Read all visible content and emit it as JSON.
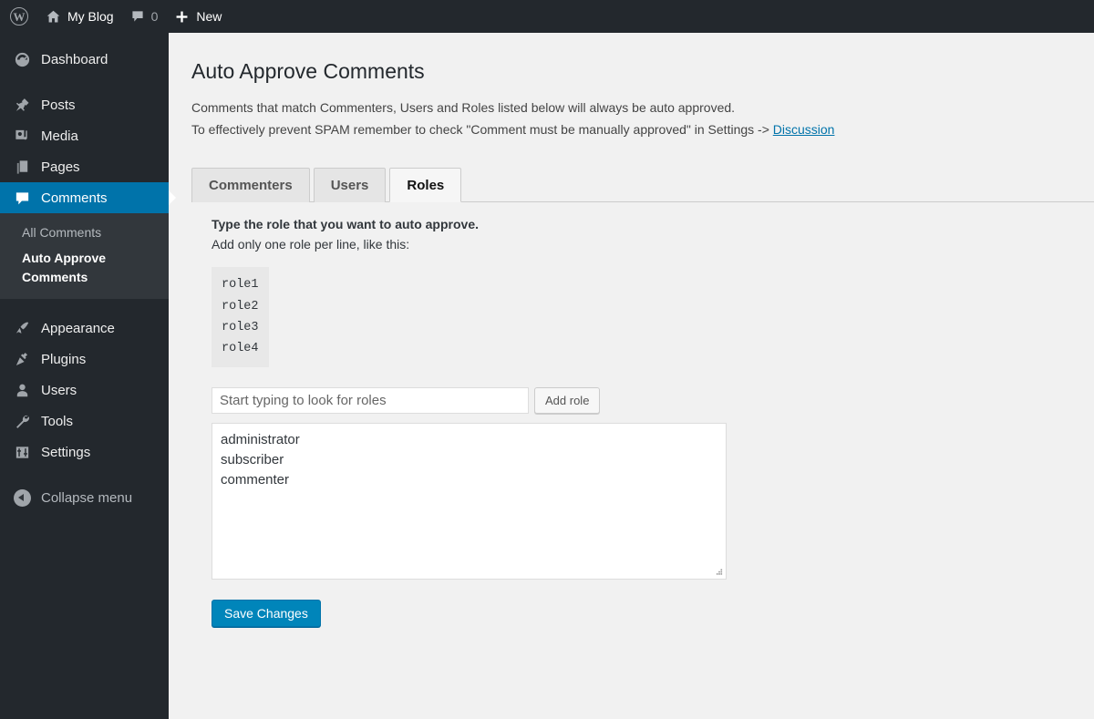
{
  "adminbar": {
    "logo_icon": "wordpress-logo-icon",
    "site_home_icon": "home-icon",
    "site_name": "My Blog",
    "comments_icon": "comment-bubble-icon",
    "comments_count": "0",
    "new_icon": "plus-icon",
    "new_label": "New"
  },
  "sidebar": {
    "items": [
      {
        "label": "Dashboard",
        "icon": "dashboard-icon",
        "current": false
      },
      {
        "label": "Posts",
        "icon": "pin-icon",
        "current": false
      },
      {
        "label": "Media",
        "icon": "media-icon",
        "current": false
      },
      {
        "label": "Pages",
        "icon": "pages-icon",
        "current": false
      },
      {
        "label": "Comments",
        "icon": "comment-bubble-icon",
        "current": true
      },
      {
        "label": "Appearance",
        "icon": "paintbrush-icon",
        "current": false
      },
      {
        "label": "Plugins",
        "icon": "plug-icon",
        "current": false
      },
      {
        "label": "Users",
        "icon": "user-icon",
        "current": false
      },
      {
        "label": "Tools",
        "icon": "wrench-icon",
        "current": false
      },
      {
        "label": "Settings",
        "icon": "settings-sliders-icon",
        "current": false
      }
    ],
    "submenu": [
      {
        "label": "All Comments",
        "current": false
      },
      {
        "label": "Auto Approve Comments",
        "current": true
      }
    ],
    "collapse": {
      "label": "Collapse menu",
      "icon": "collapse-arrow-icon"
    }
  },
  "page": {
    "title": "Auto Approve Comments",
    "desc_line1": "Comments that match Commenters, Users and Roles listed below will always be auto approved.",
    "desc_line2_before": "To effectively prevent SPAM remember to check \"Comment must be manually approved\" in Settings -> ",
    "desc_link": "Discussion"
  },
  "tabs": [
    {
      "label": "Commenters",
      "active": false
    },
    {
      "label": "Users",
      "active": false
    },
    {
      "label": "Roles",
      "active": true
    }
  ],
  "panel": {
    "hint_bold": "Type the role that you want to auto approve.",
    "hint_normal": "Add only one role per line, like this:",
    "example_lines": [
      "role1",
      "role2",
      "role3",
      "role4"
    ],
    "input_placeholder": "Start typing to look for roles",
    "input_value": "",
    "add_button_label": "Add role",
    "textarea_value": "administrator\nsubscriber\ncommenter",
    "textarea_roles": [
      "administrator",
      "subscriber",
      "commenter"
    ],
    "save_button_label": "Save Changes",
    "resize_grip_icon": "resize-handle-icon"
  },
  "colors": {
    "sidebar_bg": "#23282d",
    "submenu_bg": "#32373c",
    "accent_blue": "#0073aa",
    "button_blue": "#0085ba",
    "link_blue": "#0073aa",
    "content_bg": "#f1f1f1",
    "tab_inactive_bg": "#e5e5e5",
    "tab_active_bg": "#f6f6f6",
    "code_bg": "#e8e8e8"
  }
}
